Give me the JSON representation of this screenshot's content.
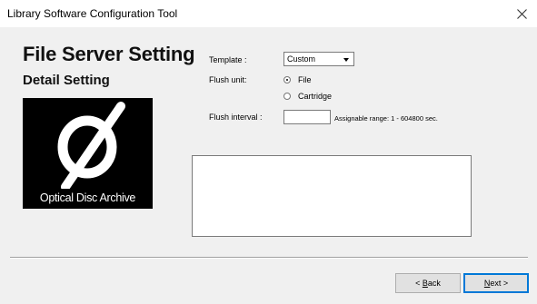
{
  "window": {
    "title": "Library Software Configuration Tool",
    "close_icon": "close-icon"
  },
  "page": {
    "heading": "File Server Setting",
    "subheading": "Detail Setting"
  },
  "logo": {
    "text": "Optical Disc Archive"
  },
  "form": {
    "template_label": "Template :",
    "template_value": "Custom",
    "flush_unit_label": "Flush unit:",
    "flush_unit_options": [
      "File",
      "Cartridge"
    ],
    "flush_unit_selected": "File",
    "flush_interval_label": "Flush interval :",
    "flush_interval_value": "",
    "flush_interval_hint": "Assignable range: 1 - 604800 sec.",
    "message_value": ""
  },
  "buttons": {
    "back_prefix": "< ",
    "back_key": "B",
    "back_rest": "ack",
    "next_key": "N",
    "next_rest": "ext >"
  },
  "colors": {
    "default_button_border": "#0078d7",
    "logo_background": "#000000"
  }
}
